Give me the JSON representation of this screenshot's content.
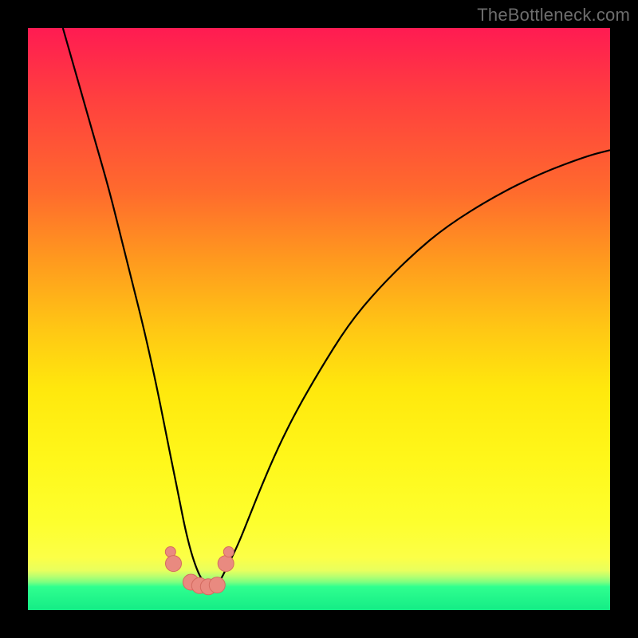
{
  "watermark": "TheBottleneck.com",
  "colors": {
    "frame": "#000000",
    "curve": "#000000",
    "marker_fill": "#e98a80",
    "marker_stroke": "#d46b60"
  },
  "chart_data": {
    "type": "line",
    "title": "",
    "xlabel": "",
    "ylabel": "",
    "xlim": [
      0,
      100
    ],
    "ylim": [
      0,
      100
    ],
    "grid": false,
    "note": "Axes are unlabeled; values are estimated positions in percent of plot area (x left→right, y bottom→top). Curve resembles a bottleneck V.",
    "series": [
      {
        "name": "bottleneck-curve",
        "x": [
          6,
          8,
          10,
          12,
          14,
          16,
          18,
          20,
          22,
          24,
          25,
          26,
          27,
          28,
          29,
          30,
          31,
          32,
          33,
          34,
          36,
          38,
          40,
          43,
          46,
          50,
          55,
          60,
          66,
          72,
          80,
          88,
          96,
          100
        ],
        "y": [
          100,
          93,
          86,
          79,
          72,
          64,
          56,
          48,
          39,
          29,
          24,
          19,
          14,
          10,
          7,
          5,
          4,
          4,
          5,
          7,
          11,
          16,
          21,
          28,
          34,
          41,
          49,
          55,
          61,
          66,
          71,
          75,
          78,
          79
        ]
      }
    ],
    "markers": {
      "name": "sample-points",
      "x": [
        24.5,
        25.0,
        28.0,
        29.5,
        31.0,
        32.5,
        34.0,
        34.5
      ],
      "y": [
        10.0,
        8.0,
        4.8,
        4.2,
        4.0,
        4.3,
        8.0,
        10.0
      ]
    }
  }
}
